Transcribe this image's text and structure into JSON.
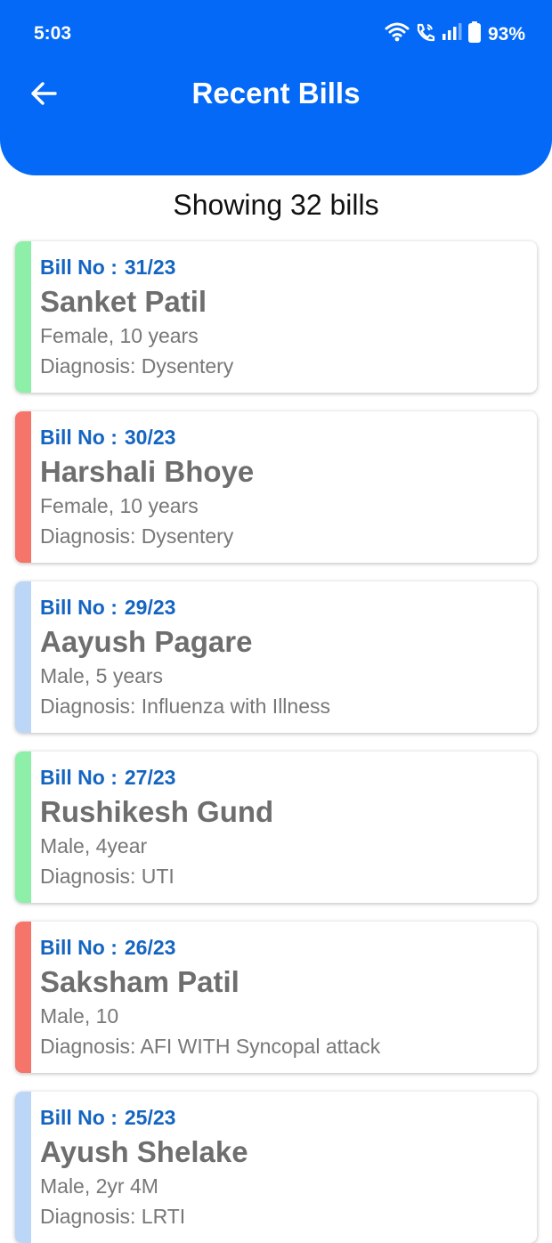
{
  "status_bar": {
    "time": "5:03",
    "battery": "93%"
  },
  "header": {
    "title": "Recent Bills"
  },
  "summary": "Showing 32 bills",
  "bill_label": "Bill No :",
  "bills": [
    {
      "bill_no": "31/23",
      "name": "Sanket Patil",
      "details": "Female, 10 years",
      "diagnosis": "Diagnosis: Dysentery",
      "accent": "#8ef0a8"
    },
    {
      "bill_no": "30/23",
      "name": "Harshali Bhoye",
      "details": "Female, 10 years",
      "diagnosis": "Diagnosis: Dysentery",
      "accent": "#f5756a"
    },
    {
      "bill_no": "29/23",
      "name": "Aayush Pagare",
      "details": "Male, 5 years",
      "diagnosis": "Diagnosis: Influenza with Illness",
      "accent": "#bcd6f7"
    },
    {
      "bill_no": "27/23",
      "name": "Rushikesh Gund",
      "details": "Male, 4year",
      "diagnosis": "Diagnosis: UTI",
      "accent": "#8ef0a8"
    },
    {
      "bill_no": "26/23",
      "name": "Saksham Patil",
      "details": "Male, 10",
      "diagnosis": "Diagnosis: AFI WITH Syncopal attack",
      "accent": "#f5756a"
    },
    {
      "bill_no": "25/23",
      "name": "Ayush Shelake",
      "details": "Male, 2yr 4M",
      "diagnosis": "Diagnosis: LRTI",
      "accent": "#bcd6f7"
    }
  ]
}
